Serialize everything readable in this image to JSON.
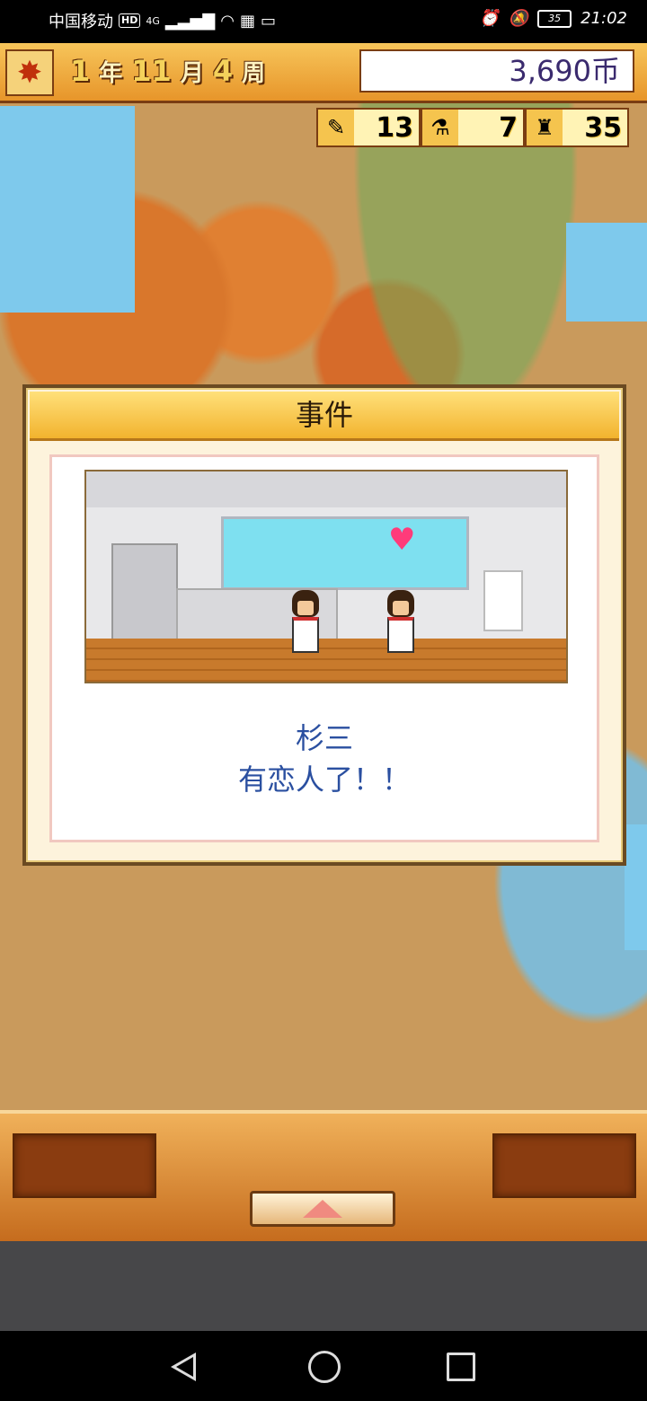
{
  "status_bar": {
    "carrier": "中国移动",
    "hd": "HD",
    "network": "4G",
    "battery": "35",
    "time": "21:02"
  },
  "hud": {
    "season_icon": "maple-leaf-icon",
    "year": "1",
    "year_unit": "年",
    "month": "11",
    "month_unit": "月",
    "week": "4",
    "week_unit": "周",
    "money": "3,690币",
    "stats": [
      {
        "icon": "pencil-icon",
        "value": "13"
      },
      {
        "icon": "flask-icon",
        "value": "7"
      },
      {
        "icon": "trophy-icon",
        "value": "35"
      }
    ]
  },
  "event_dialog": {
    "title": "事件",
    "message_line1": "杉三",
    "message_line2": "有恋人了！！"
  },
  "bottom_bar": {
    "up_button_icon": "arrow-up-icon"
  },
  "colors": {
    "hud_gold": "#f7c55a",
    "dialog_text": "#2a4fa0",
    "bottom_orange": "#e08a34"
  }
}
